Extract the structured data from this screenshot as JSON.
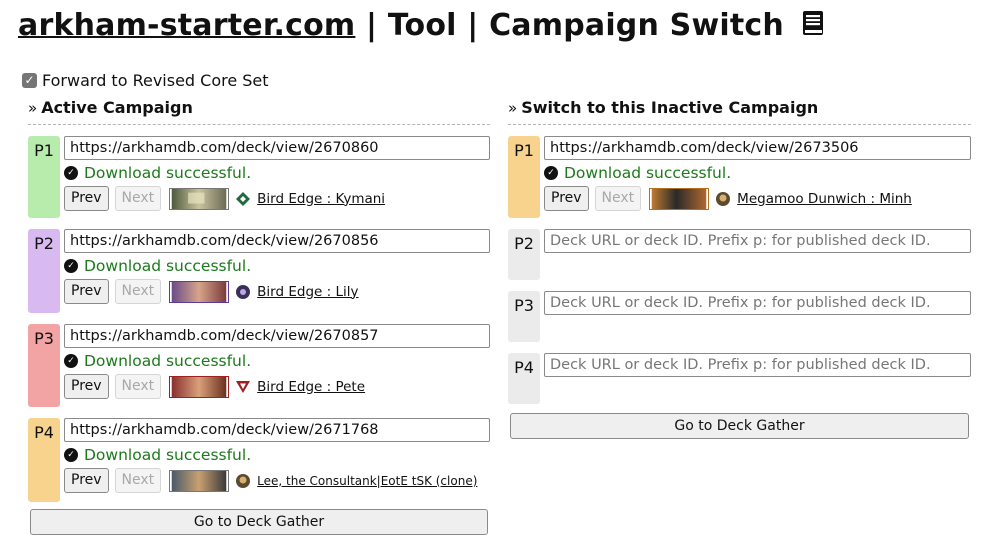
{
  "title": {
    "site": "arkham-starter.com",
    "rest": " | Tool | Campaign Switch "
  },
  "options": {
    "forward_label": "Forward to Revised Core Set",
    "forward_checked": true
  },
  "active": {
    "heading": "Active Campaign",
    "slots": [
      {
        "tag": "P1",
        "url": "https://arkhamdb.com/deck/view/2670860",
        "status": "Download successful.",
        "prev": "Prev",
        "next": "Next",
        "deck_name": "Bird Edge : Kymani",
        "faction": "rogue"
      },
      {
        "tag": "P2",
        "url": "https://arkhamdb.com/deck/view/2670856",
        "status": "Download successful.",
        "prev": "Prev",
        "next": "Next",
        "deck_name": "Bird Edge : Lily",
        "faction": "mystic"
      },
      {
        "tag": "P3",
        "url": "https://arkhamdb.com/deck/view/2670857",
        "status": "Download successful.",
        "prev": "Prev",
        "next": "Next",
        "deck_name": "Bird Edge : Pete",
        "faction": "survivor"
      },
      {
        "tag": "P4",
        "url": "https://arkhamdb.com/deck/view/2671768",
        "status": "Download successful.",
        "prev": "Prev",
        "next": "Next",
        "deck_name": "Lee, the Consultank|EotE tSK (clone)",
        "faction": "guardian"
      }
    ],
    "gather_label": "Go to Deck Gather"
  },
  "inactive": {
    "heading": "Switch to this Inactive Campaign",
    "slots": [
      {
        "tag": "P1",
        "url": "https://arkhamdb.com/deck/view/2673506",
        "status": "Download successful.",
        "prev": "Prev",
        "next": "Next",
        "deck_name": "Megamoo Dunwich : Minh",
        "faction": "seeker"
      },
      {
        "tag": "P2",
        "placeholder": "Deck URL or deck ID. Prefix p: for published deck ID."
      },
      {
        "tag": "P3",
        "placeholder": "Deck URL or deck ID. Prefix p: for published deck ID."
      },
      {
        "tag": "P4",
        "placeholder": "Deck URL or deck ID. Prefix p: for published deck ID."
      }
    ],
    "gather_label": "Go to Deck Gather"
  },
  "colors": {
    "p1_active": "#b8ecad",
    "p2_active": "#d8b9f0",
    "p3_active": "#f2a3a3",
    "p4_active": "#f7d38e",
    "empty_slot": "#ebebeb",
    "success": "#1c7a1c"
  },
  "icons": {
    "title": "book-icon",
    "section": "double-chevron-right-icon",
    "status": "check-circle-icon"
  }
}
